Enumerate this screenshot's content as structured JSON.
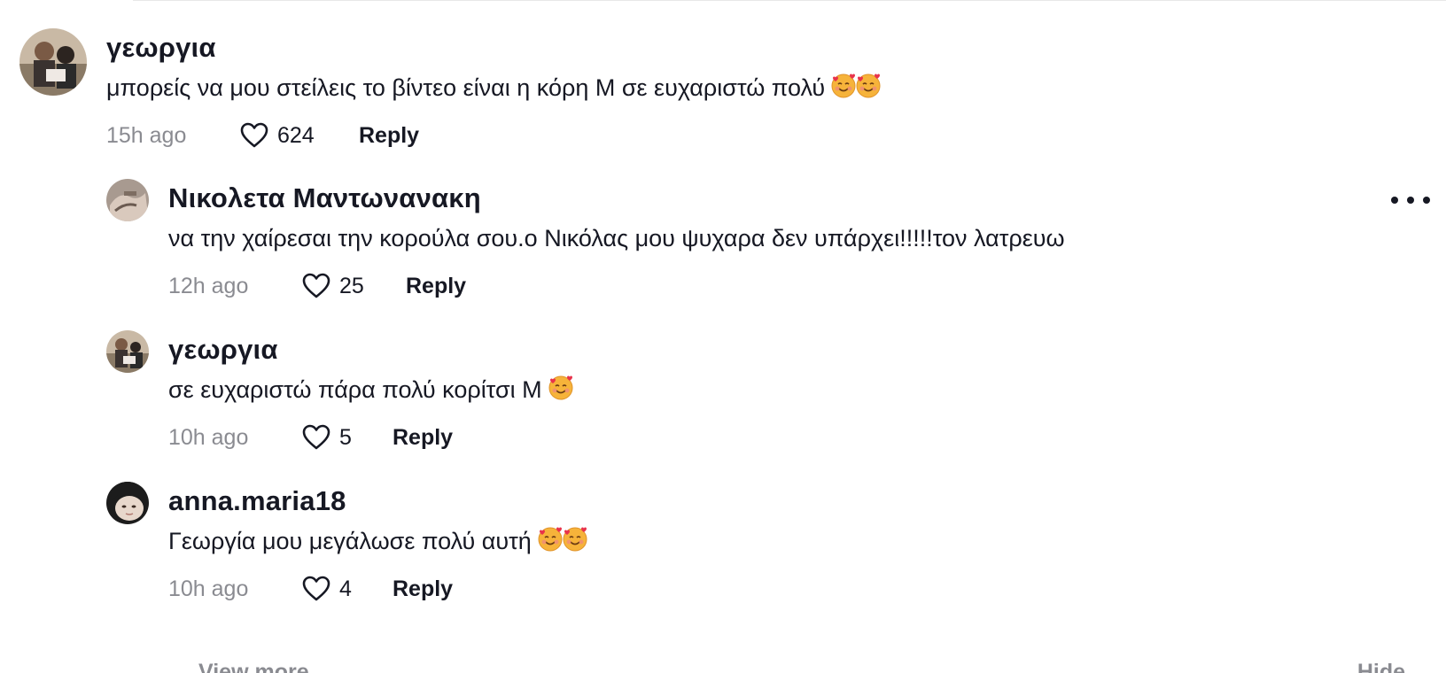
{
  "comments": [
    {
      "username": "γεωργια",
      "text": "μπορείς να μου στείλεις το βίντεο είναι η κόρη Μ σε ευχαριστώ πολύ",
      "emojis": [
        "smiling-face-with-hearts",
        "smiling-face-with-hearts"
      ],
      "time": "15h ago",
      "likes": "624",
      "reply_label": "Reply",
      "is_reply": false
    },
    {
      "username": "Νικολετα Μαντωνανακη",
      "text": "να την χαίρεσαι την κορούλα σου.ο Νικόλας μου ψυχαρα δεν υπάρχει!!!!!τον λατρευω",
      "emojis": [],
      "time": "12h ago",
      "likes": "25",
      "reply_label": "Reply",
      "is_reply": true
    },
    {
      "username": "γεωργια",
      "text": "σε ευχαριστώ πάρα πολύ κορίτσι Μ",
      "emojis": [
        "smiling-face-with-hearts"
      ],
      "time": "10h ago",
      "likes": "5",
      "reply_label": "Reply",
      "is_reply": true
    },
    {
      "username": "anna.maria18",
      "text": "Γεωργία μου μεγάλωσε πολύ αυτή",
      "emojis": [
        "smiling-face-with-hearts",
        "smiling-face-with-hearts"
      ],
      "time": "10h ago",
      "likes": "4",
      "reply_label": "Reply",
      "is_reply": true
    }
  ],
  "footer": {
    "view_more_label": "View more",
    "hide_label": "Hide"
  },
  "icons": {
    "like": "heart-outline-icon",
    "more": "more-horizontal-icon",
    "emoji": "smiling-face-with-hearts"
  },
  "colors": {
    "text_primary": "#161823",
    "text_secondary": "#8a8b91",
    "divider": "#e8e8e8"
  }
}
